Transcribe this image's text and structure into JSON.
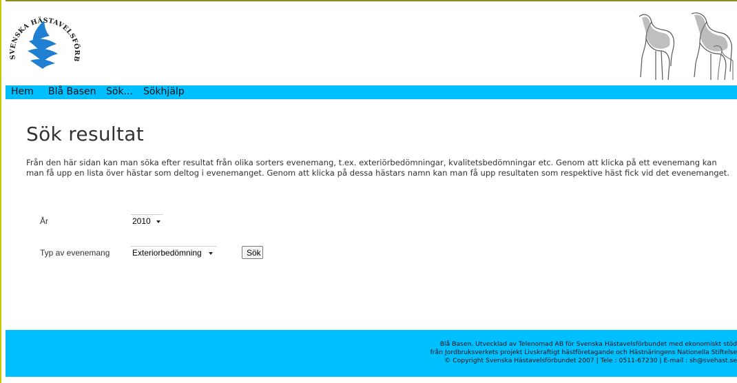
{
  "header": {
    "logo_text": "SVENSKA HÄSTAVELSFÖRBUNDET"
  },
  "nav": {
    "items": [
      {
        "label": "Hem"
      },
      {
        "label": "Blå Basen"
      },
      {
        "label": "Sök..."
      },
      {
        "label": "Sökhjälp"
      }
    ]
  },
  "main": {
    "title": "Sök resultat",
    "intro": "Från den här sidan kan man söka efter resultat från olika sorters evenemang, t.ex. exteriörbedömningar, kvalitetsbedömningar etc. Genom att klicka på ett evenemang kan man få upp en lista över hästar som deltog i evenemanget. Genom att klicka på dessa hästars namn kan man få upp resultaten som respektive häst fick vid det evenemanget."
  },
  "form": {
    "year_label": "År",
    "year_value": "2010",
    "event_type_label": "Typ av evenemang",
    "event_type_value": "Exteriorbedömning",
    "search_button": "Sök"
  },
  "footer": {
    "line1": "Blå Basen. Utvecklad av Telenomad AB för Svenska Hästavelsförbundet med ekonomiskt stöd",
    "line2": "från Jordbruksverkets projekt Livskraftigt hästföretagande och Hästnäringens Nationella Stiftelse",
    "line3": "© Copyright Svenska Hästavelsförbundet 2007 | Tele : 0511-67230 | E-mail : sh@svehast.se"
  },
  "colors": {
    "accent": "#00bfff",
    "logo_blue": "#1f7fd0",
    "text": "#333333"
  }
}
